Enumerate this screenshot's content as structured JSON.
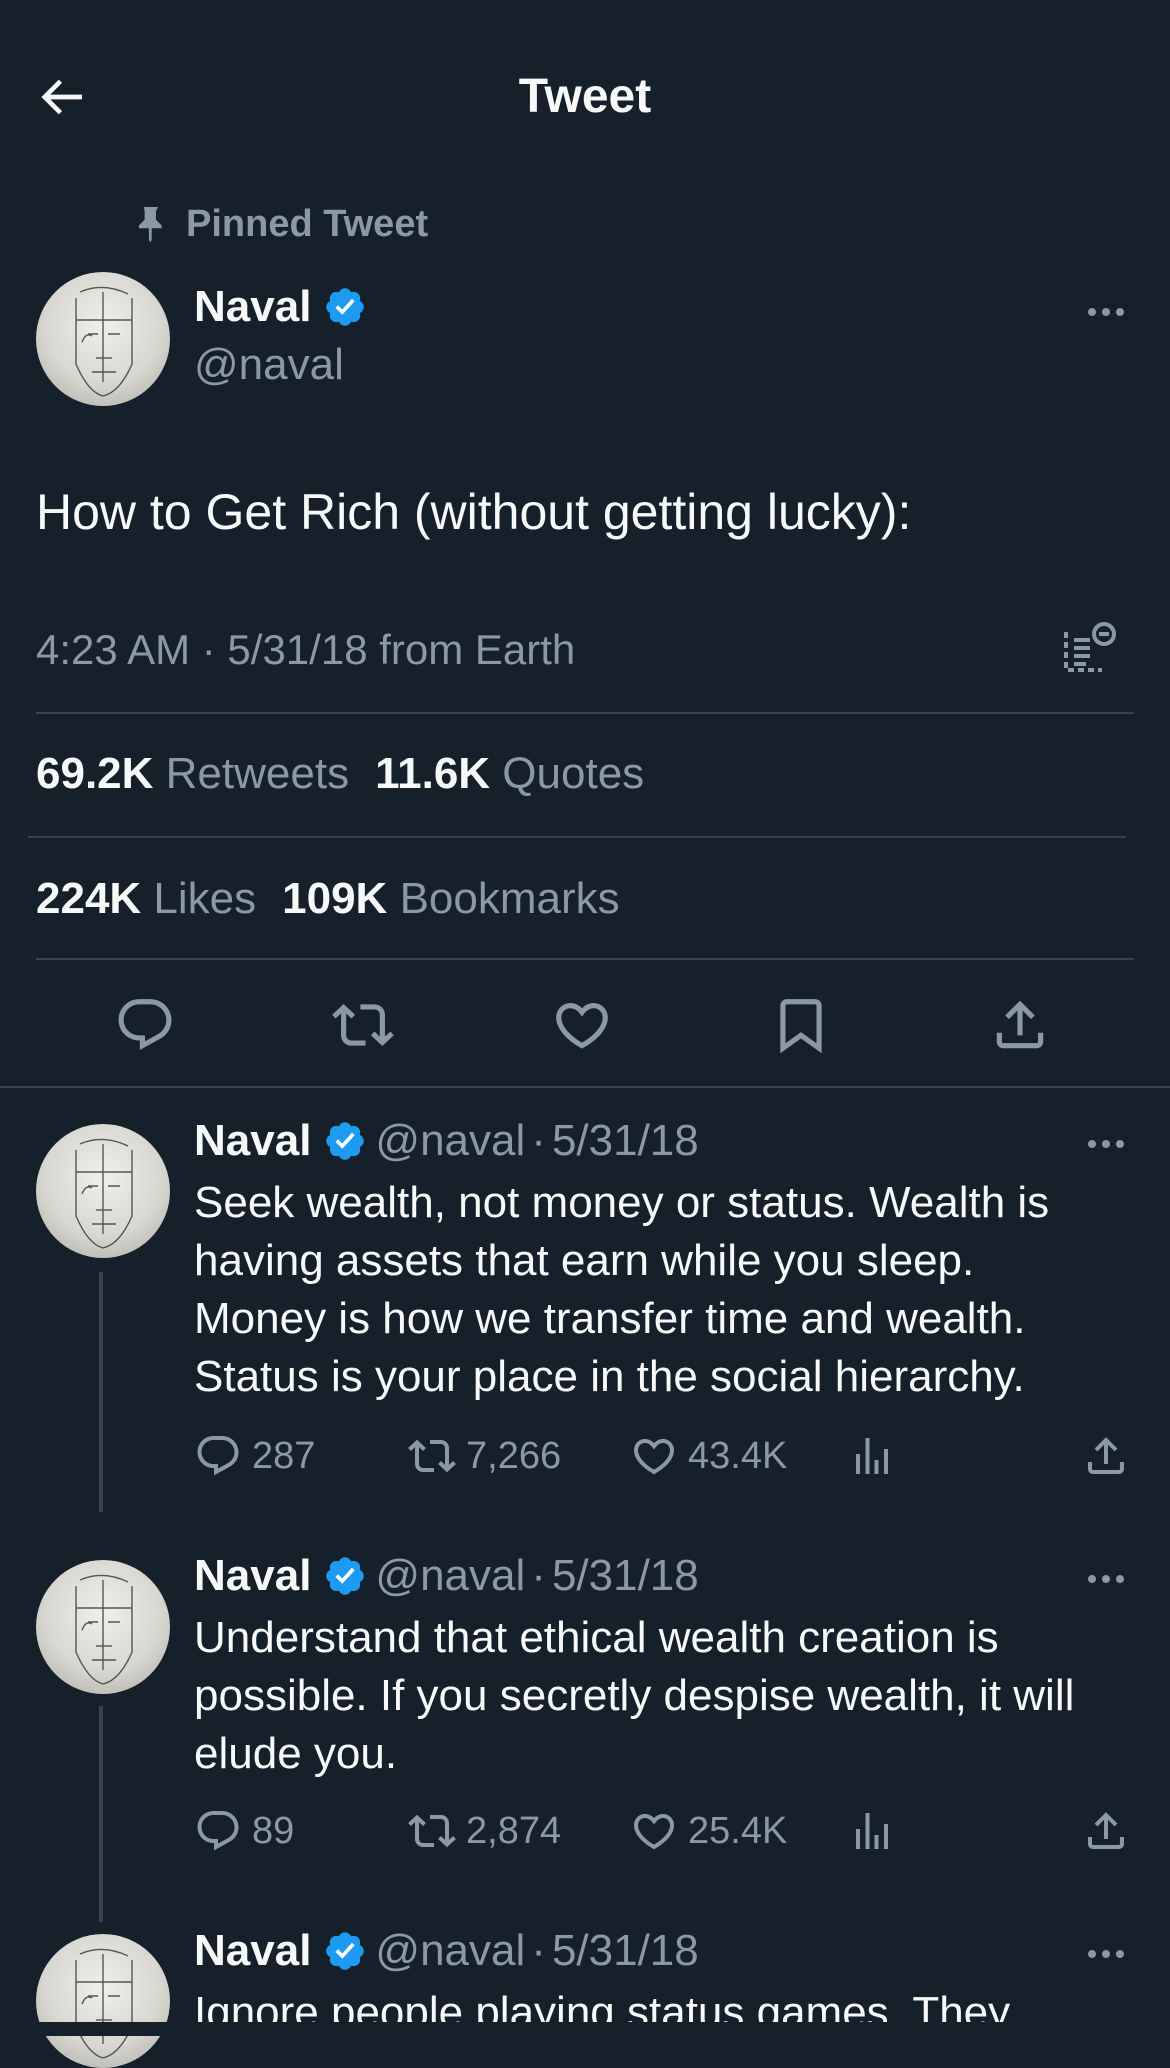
{
  "header": {
    "title": "Tweet"
  },
  "pinned_label": "Pinned Tweet",
  "main_tweet": {
    "name": "Naval",
    "handle": "@naval",
    "text": "How to Get Rich (without getting lucky):",
    "meta": "4:23 AM · 5/31/18 from Earth",
    "stats": {
      "retweets_count": "69.2K",
      "retweets_label": "Retweets",
      "quotes_count": "11.6K",
      "quotes_label": "Quotes",
      "likes_count": "224K",
      "likes_label": "Likes",
      "bookmarks_count": "109K",
      "bookmarks_label": "Bookmarks"
    }
  },
  "replies": [
    {
      "name": "Naval",
      "handle": "@naval",
      "date": "5/31/18",
      "text": "Seek wealth, not money or status. Wealth is having assets that earn while you sleep. Money is how we transfer time and wealth. Status is your place in the social hierarchy.",
      "replies": "287",
      "retweets": "7,266",
      "likes": "43.4K"
    },
    {
      "name": "Naval",
      "handle": "@naval",
      "date": "5/31/18",
      "text": "Understand that ethical wealth creation is possible. If you secretly despise wealth, it will elude you.",
      "replies": "89",
      "retweets": "2,874",
      "likes": "25.4K"
    },
    {
      "name": "Naval",
      "handle": "@naval",
      "date": "5/31/18",
      "text": "Ignore people playing status games. They"
    }
  ],
  "colors": {
    "background": "#15202b",
    "text": "#f7f9f9",
    "secondary": "#8b98a5",
    "divider": "#38444d",
    "verified": "#1d9bf0"
  },
  "icons": [
    "back-arrow-icon",
    "pin-icon",
    "verified-badge-icon",
    "more-icon",
    "analytics-icon",
    "reply-icon",
    "retweet-icon",
    "like-icon",
    "bookmark-icon",
    "share-icon",
    "views-icon"
  ]
}
